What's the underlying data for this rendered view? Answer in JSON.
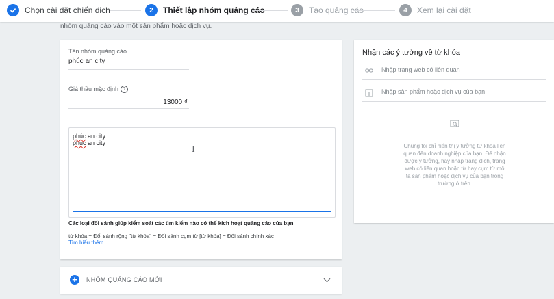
{
  "stepper": {
    "steps": [
      {
        "num": "✓",
        "label": "Chọn cài đặt chiến dịch",
        "state": "done"
      },
      {
        "num": "2",
        "label": "Thiết lập nhóm quảng cáo",
        "state": "active"
      },
      {
        "num": "3",
        "label": "Tạo quảng cáo",
        "state": "pending"
      },
      {
        "num": "4",
        "label": "Xem lại cài đặt",
        "state": "pending"
      }
    ]
  },
  "intro_text": "nhóm quảng cáo vào một sản phẩm hoặc dịch vụ.",
  "ad_group": {
    "name_label": "Tên nhóm quảng cáo",
    "name_value": "phúc an city",
    "bid_label": "Giá thầu mặc định",
    "bid_help": "?",
    "bid_value": "13000 ₫",
    "keywords": [
      {
        "u": "phúc",
        "rest": " an city"
      },
      {
        "u": "phuc",
        "rest": " an city"
      }
    ],
    "match_title": "Các loại đối sánh giúp kiểm soát các tìm kiếm nào có thể kích hoạt quảng cáo của bạn",
    "match_types": "từ khóa = Đối sánh rộng  \"từ khóa\" = Đối sánh cụm từ  [từ khóa] = Đối sánh chính xác",
    "learn_more": "Tìm hiểu thêm"
  },
  "new_ad_group": {
    "plus": "+",
    "label": "NHÓM QUẢNG CÁO MỚI"
  },
  "keyword_ideas": {
    "title": "Nhận các ý tưởng về từ khóa",
    "url_placeholder": "Nhập trang web có liên quan",
    "product_placeholder": "Nhập sản phẩm hoặc dịch vụ của bạn",
    "empty_text": "Chúng tôi chỉ hiển thị ý tưởng từ khóa liên quan đến doanh nghiệp của bạn. Để nhận được ý tưởng, hãy nhập trang đích, trang web có liên quan hoặc từ hay cụm từ mô tả sản phẩm hoặc dịch vụ của bạn trong trường ở trên."
  },
  "colors": {
    "accent": "#1a73e8",
    "pending": "#9aa0a6",
    "background": "#eceff1"
  }
}
